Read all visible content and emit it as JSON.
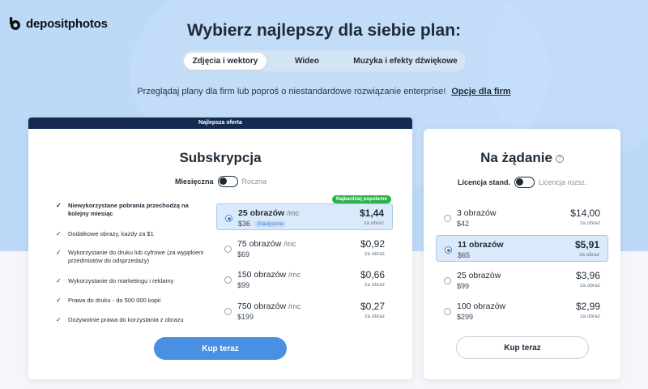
{
  "brand": {
    "name": "depositphotos"
  },
  "headline": "Wybierz najlepszy dla siebie plan:",
  "tabs": [
    {
      "label": "Zdjęcia i wektory",
      "active": true
    },
    {
      "label": "Wideo",
      "active": false
    },
    {
      "label": "Muzyka i efekty dźwiękowe",
      "active": false
    }
  ],
  "subline": {
    "text": "Przeglądaj plany dla firm lub poproś o niestandardowe rozwiązanie enterprise!",
    "link": "Opcje dla firm"
  },
  "subscription": {
    "banner": "Najlepsza oferta",
    "title": "Subskrypcja",
    "toggle_on": "Miesięczna",
    "toggle_off": "Roczna",
    "features": [
      "Niewykorzystane pobrania przechodzą na kolejny miesiąc",
      "Dodatkowe obrazy, każdy za $1",
      "Wykorzystanie do druku lub cyfrowe (za wyjątkiem przedmiotów do odsprzedaży)",
      "Wykorzystanie do marketingu i reklamy",
      "Prawa do druku - do 500 000 kopii",
      "Dożywotnie prawa do korzystania z obrazu"
    ],
    "popular_badge": "Najbardziej popularne",
    "options": [
      {
        "count": "25 obrazów",
        "unit": "/mc",
        "price": "$36",
        "badge": "Elastyczne",
        "rate": "$1,44",
        "per": "za obraz",
        "selected": true
      },
      {
        "count": "75 obrazów",
        "unit": "/mc",
        "price": "$69",
        "rate": "$0,92",
        "per": "za obraz",
        "selected": false
      },
      {
        "count": "150 obrazów",
        "unit": "/mc",
        "price": "$99",
        "rate": "$0,66",
        "per": "za obraz",
        "selected": false
      },
      {
        "count": "750 obrazów",
        "unit": "/mc",
        "price": "$199",
        "rate": "$0,27",
        "per": "za obraz",
        "selected": false
      }
    ],
    "button": "Kup teraz"
  },
  "ondemand": {
    "title": "Na żądanie",
    "info_icon": "?",
    "toggle_on": "Licencja stand.",
    "toggle_off": "Licencja rozsz.",
    "options": [
      {
        "count": "3 obrazów",
        "price": "$42",
        "rate": "$14,00",
        "per": "za obraz",
        "selected": false
      },
      {
        "count": "11 obrazów",
        "price": "$65",
        "rate": "$5,91",
        "per": "za obraz",
        "selected": true
      },
      {
        "count": "25 obrazów",
        "price": "$99",
        "rate": "$3,96",
        "per": "za obraz",
        "selected": false
      },
      {
        "count": "100 obrazów",
        "price": "$299",
        "rate": "$2,99",
        "per": "za obraz",
        "selected": false
      }
    ],
    "button": "Kup teraz"
  },
  "colors": {
    "accent": "#4a90e2",
    "banner": "#142a51",
    "popular": "#2bb24c",
    "background": "#bcd9f7"
  }
}
